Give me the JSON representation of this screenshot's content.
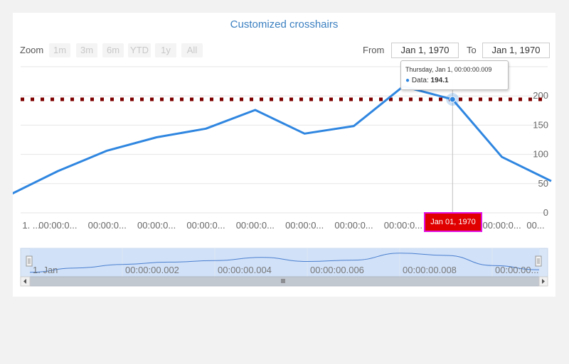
{
  "chart_title": "Customized crosshairs",
  "zoom": {
    "label": "Zoom",
    "buttons": [
      "1m",
      "3m",
      "6m",
      "YTD",
      "1y",
      "All"
    ]
  },
  "range": {
    "from_label": "From",
    "from_value": "Jan 1, 1970",
    "to_label": "To",
    "to_value": "Jan 1, 1970"
  },
  "tooltip": {
    "date": "Thursday, Jan 1, 00:00:00.009",
    "series": "Data",
    "value": "194.1"
  },
  "crosshair_label": "Jan 01, 1970",
  "colors": {
    "line": "#2f86e0",
    "plot_band": "#7f0000",
    "crosshair_label_bg": "#e00000",
    "crosshair_label_border": "#e010e0"
  },
  "chart_data": {
    "type": "line",
    "series": [
      {
        "name": "Data",
        "x": [
          0,
          0.001,
          0.002,
          0.003,
          0.004,
          0.005,
          0.006,
          0.007,
          0.008,
          0.009,
          0.01,
          0.011
        ],
        "values": [
          29.9,
          71.5,
          106.4,
          129.2,
          144.0,
          176.0,
          135.6,
          148.5,
          216.4,
          194.1,
          95.6,
          54.4
        ]
      }
    ],
    "x_tick_labels": [
      "1. ...",
      "00:00:0...",
      "00:00:0...",
      "00:00:0...",
      "00:00:0...",
      "00:00:0...",
      "00:00:0...",
      "00:00:0...",
      "00:00:0...",
      "00:00:0...",
      "00:00:0...",
      "00..."
    ],
    "y_ticks": [
      "0",
      "50",
      "100",
      "150",
      "200"
    ],
    "ylim": [
      0,
      250
    ],
    "plot_line_value": 194.1,
    "grid": true,
    "navigator": {
      "tick_labels": [
        "1. Jan",
        "00:00:00.002",
        "00:00:00.004",
        "00:00:00.006",
        "00:00:00.008",
        "00:00:00..."
      ]
    }
  }
}
